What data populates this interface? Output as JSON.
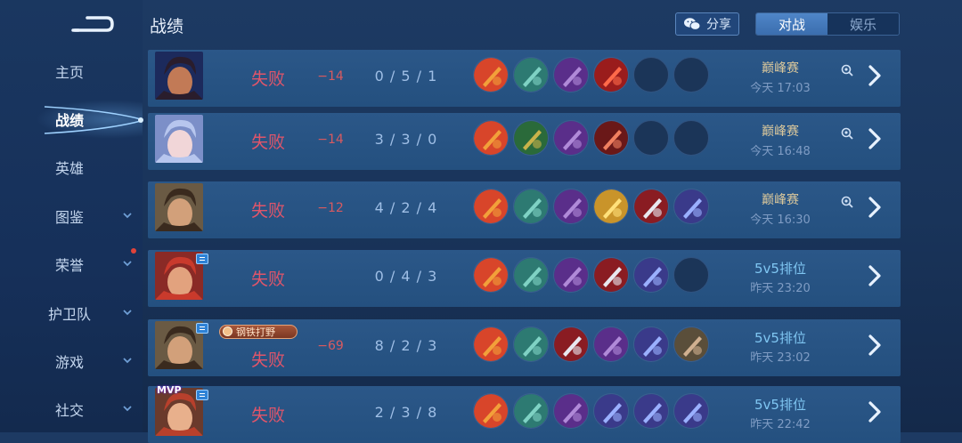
{
  "header": {
    "title": "战绩",
    "share_label": "分享",
    "tabs": [
      "对战",
      "娱乐"
    ]
  },
  "sidebar": {
    "items": [
      {
        "label": "主页"
      },
      {
        "label": "战绩"
      },
      {
        "label": "英雄"
      },
      {
        "label": "图鉴"
      },
      {
        "label": "荣誉"
      },
      {
        "label": "护卫队"
      },
      {
        "label": "游戏"
      },
      {
        "label": "社交"
      }
    ]
  },
  "matches": [
    {
      "result": "失败",
      "delta": "−14",
      "kda": "0 / 5 / 1",
      "mode": "巅峰赛",
      "time": "今天 17:03",
      "items_filled": 4
    },
    {
      "result": "失败",
      "delta": "−14",
      "kda": "3 / 3 / 0",
      "mode": "巅峰赛",
      "time": "今天 16:48",
      "items_filled": 4
    },
    {
      "result": "失败",
      "delta": "−12",
      "kda": "4 / 2 / 4",
      "mode": "巅峰赛",
      "time": "今天 16:30",
      "items_filled": 6
    },
    {
      "result": "失败",
      "delta": "",
      "kda": "0 / 4 / 3",
      "mode": "5v5排位",
      "time": "昨天 23:20",
      "items_filled": 5
    },
    {
      "result": "失败",
      "delta": "−69",
      "kda": "8 / 2 / 3",
      "mode": "5v5排位",
      "time": "昨天 23:02",
      "items_filled": 6,
      "tag": "钢铁打野"
    },
    {
      "result": "失败",
      "delta": "",
      "kda": "2 / 3 / 8",
      "mode": "5v5排位",
      "time": "昨天 22:42",
      "items_filled": 6,
      "badge": "MVP"
    }
  ],
  "colors": {
    "loss": "#e0556a",
    "accent": "#4f86c8",
    "peak_mode": "#d9c79c",
    "rank_mode": "#7fc6f2"
  },
  "icons": [
    "back-icon",
    "wechat-icon",
    "chevron-down-icon",
    "watch-replay-icon",
    "chevron-right-icon"
  ]
}
